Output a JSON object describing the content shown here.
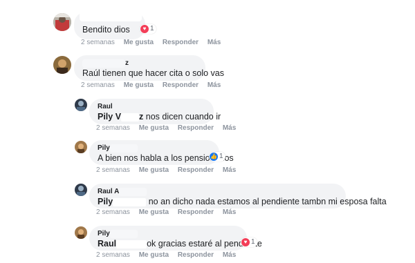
{
  "colors": {
    "bubble_bg": "#f2f3f5",
    "love": "#f33e58",
    "like": "#1877f2",
    "meta_text": "#8d949e"
  },
  "actions": {
    "like": "Me gusta",
    "reply": "Responder",
    "more": "Más"
  },
  "comments": [
    {
      "author": "",
      "text": "Bendito dios",
      "time": "2 semanas",
      "reaction": {
        "icon": "love-icon",
        "count": "1"
      }
    },
    {
      "author": "z",
      "text": "Raúl tienen que hacer cita o solo vas",
      "time": "2 semanas"
    },
    {
      "author": "Raul",
      "mention": "Pily V",
      "mention_tail": "z",
      "text": " nos dicen cuando ir",
      "time": "2 semanas"
    },
    {
      "author": "Pily",
      "text": "A bien nos habla a los pensionados",
      "time": "2 semanas",
      "reaction": {
        "icon": "like-icon",
        "count": "1"
      }
    },
    {
      "author": "Raul A",
      "mention": "Pily",
      "text": "no an dicho nada estamos al pendiente tambn mi esposa falta",
      "time": "2 semanas"
    },
    {
      "author": "Pily",
      "mention": "Raul",
      "text": "ok gracias estaré al pendiente",
      "time": "2 semanas",
      "reaction": {
        "icon": "love-icon",
        "count": "1"
      }
    }
  ]
}
